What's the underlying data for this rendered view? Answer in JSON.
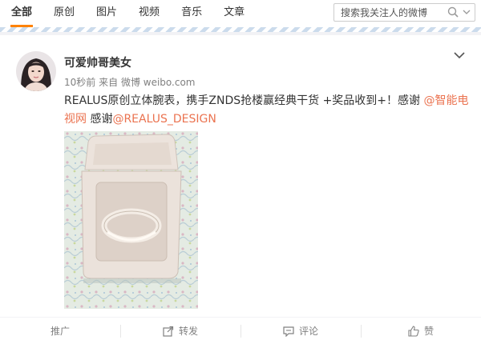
{
  "tabs": [
    {
      "label": "全部",
      "active": true
    },
    {
      "label": "原创"
    },
    {
      "label": "图片"
    },
    {
      "label": "视频"
    },
    {
      "label": "音乐"
    },
    {
      "label": "文章"
    }
  ],
  "search": {
    "placeholder": "搜索我关注人的微博"
  },
  "post": {
    "username": "可爱帅哥美女",
    "time": "10秒前",
    "source_prefix": "来自",
    "source": "微博 weibo.com",
    "text_1": "REALUS原创立体腕表，携手ZNDS抢楼赢经典干货 +奖品收到+！感谢 ",
    "mention_1": "@智能电视网",
    "text_2": "  感谢",
    "mention_2": "@REALUS_DESIGN"
  },
  "actions": {
    "promote": "推广",
    "repost": "转发",
    "comment": "评论",
    "like": "赞"
  },
  "colors": {
    "accent": "#ff8200",
    "mention": "#eb7350"
  }
}
